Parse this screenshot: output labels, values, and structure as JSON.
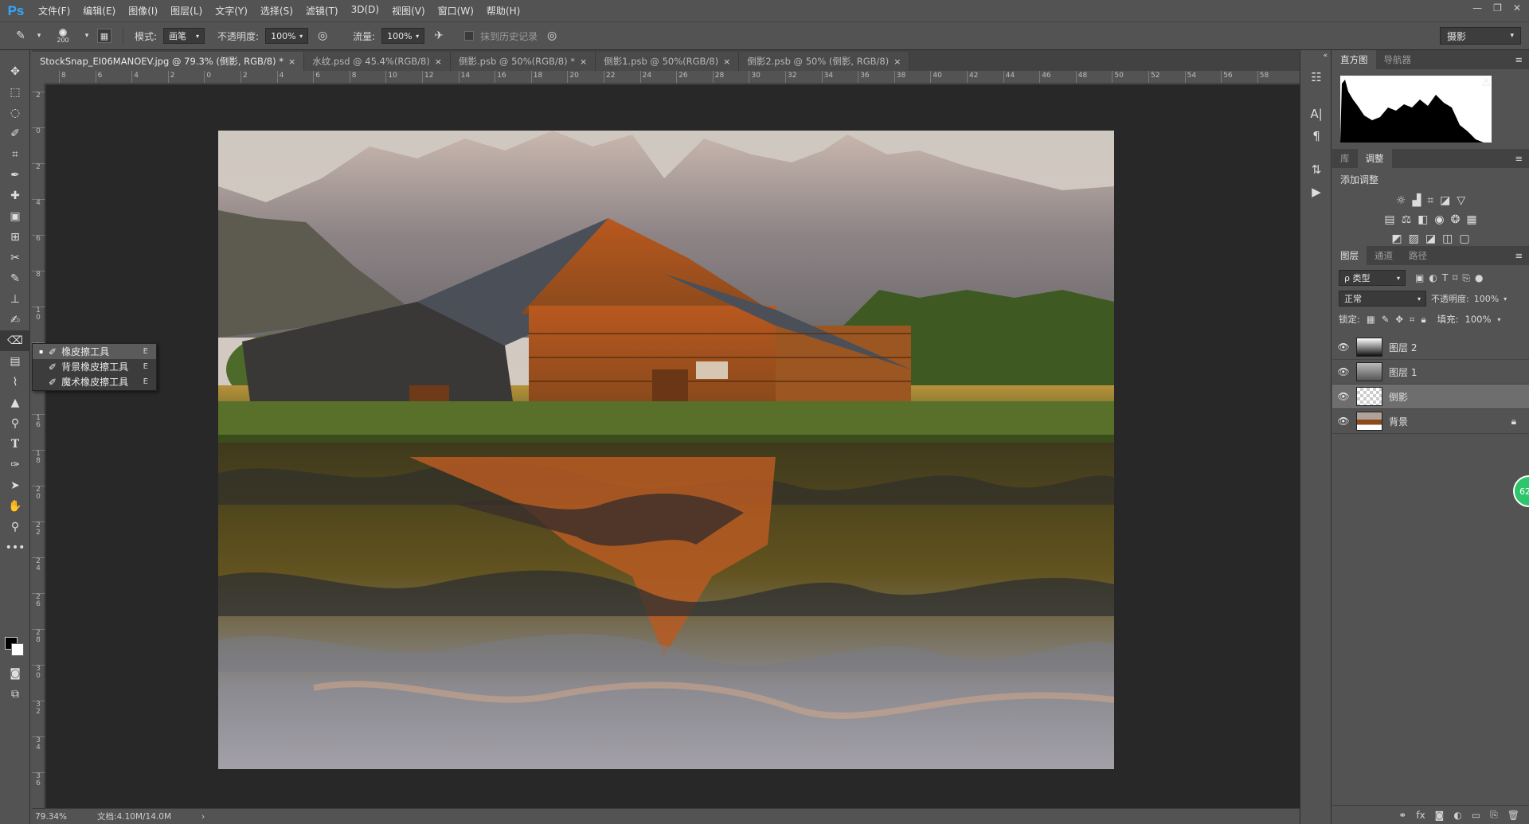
{
  "app": {
    "logo": "Ps"
  },
  "menu": [
    "文件(F)",
    "编辑(E)",
    "图像(I)",
    "图层(L)",
    "文字(Y)",
    "选择(S)",
    "滤镜(T)",
    "3D(D)",
    "视图(V)",
    "窗口(W)",
    "帮助(H)"
  ],
  "window_controls": [
    "—",
    "❐",
    "✕"
  ],
  "options": {
    "brush_size": "200",
    "mode_label": "模式:",
    "mode_value": "画笔",
    "opacity_label": "不透明度:",
    "opacity_value": "100%",
    "flow_label": "流量:",
    "flow_value": "100%",
    "erase_history_label": "抹到历史记录",
    "workspace": "摄影"
  },
  "tabs": [
    {
      "label": "StockSnap_EI06MANOEV.jpg @ 79.3% (倒影, RGB/8) *",
      "active": true
    },
    {
      "label": "水纹.psd @ 45.4%(RGB/8)",
      "active": false
    },
    {
      "label": "倒影.psb @ 50%(RGB/8) *",
      "active": false
    },
    {
      "label": "倒影1.psb @ 50%(RGB/8)",
      "active": false
    },
    {
      "label": "倒影2.psb @ 50% (倒影, RGB/8)",
      "active": false
    }
  ],
  "ruler_top_labels": [
    "8",
    "6",
    "4",
    "2",
    "0",
    "2",
    "4",
    "6",
    "8",
    "10",
    "12",
    "14",
    "16",
    "18",
    "20",
    "22",
    "24",
    "26",
    "28",
    "30",
    "32",
    "34",
    "36",
    "38",
    "40",
    "42",
    "44",
    "46",
    "48",
    "50",
    "52",
    "54",
    "56",
    "58"
  ],
  "ruler_left_labels": [
    "2",
    "0",
    "2",
    "4",
    "6",
    "8",
    "1\n0",
    "1\n2",
    "1\n4",
    "1\n6",
    "1\n8",
    "2\n0",
    "2\n2",
    "2\n4",
    "2\n6",
    "2\n8",
    "3\n0",
    "3\n2",
    "3\n4",
    "3\n6"
  ],
  "flyout": [
    {
      "label": "橡皮擦工具",
      "key": "E",
      "selected": true
    },
    {
      "label": "背景橡皮擦工具",
      "key": "E",
      "selected": false
    },
    {
      "label": "魔术橡皮擦工具",
      "key": "E",
      "selected": false
    }
  ],
  "status": {
    "zoom": "79.34%",
    "doc": "文档:4.10M/14.0M"
  },
  "histogram_panel": {
    "tabs": [
      "直方图",
      "导航器"
    ]
  },
  "adjust_panel": {
    "tabs": [
      "库",
      "调整"
    ],
    "title": "添加调整"
  },
  "layers_panel": {
    "tabs": [
      "图层",
      "通道",
      "路径"
    ],
    "kind_filter": "ρ 类型",
    "blend_mode": "正常",
    "opacity_label": "不透明度:",
    "opacity_value": "100%",
    "lock_label": "锁定:",
    "fill_label": "填充:",
    "fill_value": "100%",
    "layers": [
      {
        "name": "图层 2",
        "selected": false
      },
      {
        "name": "图层 1",
        "selected": false
      },
      {
        "name": "倒影",
        "selected": true
      },
      {
        "name": "背景",
        "selected": false
      }
    ]
  },
  "badge": "62"
}
